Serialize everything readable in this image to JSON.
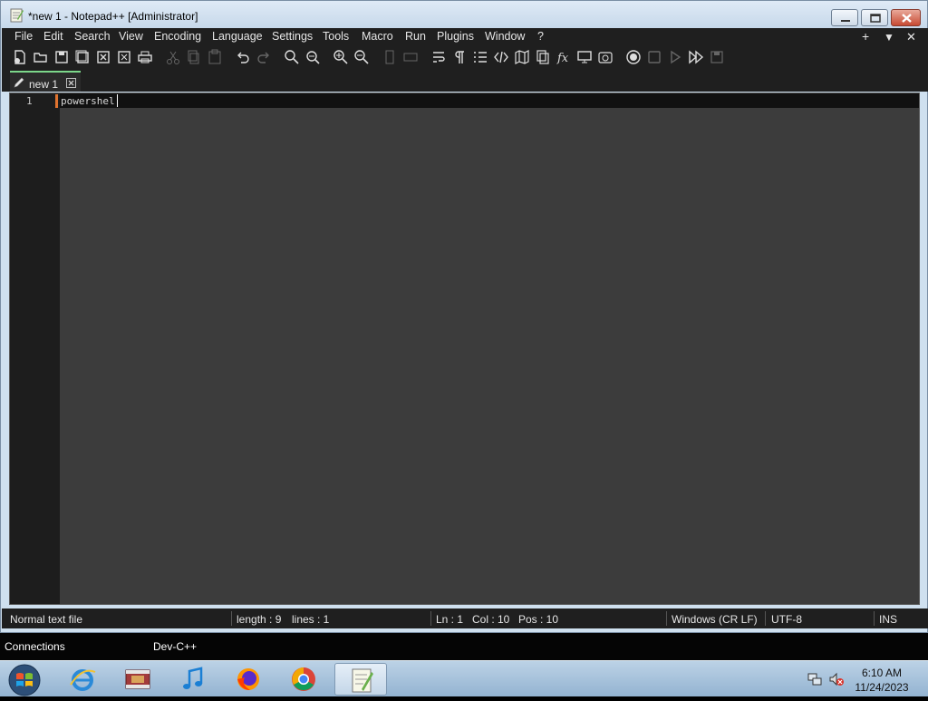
{
  "window": {
    "title": "*new 1 - Notepad++ [Administrator]"
  },
  "menu": {
    "items": [
      "File",
      "Edit",
      "Search",
      "View",
      "Encoding",
      "Language",
      "Settings",
      "Tools",
      "Macro",
      "Run",
      "Plugins",
      "Window",
      "?"
    ],
    "right": [
      "+",
      "▼",
      "✕"
    ]
  },
  "tabs": [
    {
      "label": "new 1"
    }
  ],
  "editor": {
    "line_number": "1",
    "text": "powershel"
  },
  "status": {
    "file_type": "Normal text file",
    "length": "length : 9",
    "lines": "lines : 1",
    "ln": "Ln : 1",
    "col": "Col : 10",
    "pos": "Pos : 10",
    "eol": "Windows (CR LF)",
    "encoding": "UTF-8",
    "mode": "INS"
  },
  "pinned_bar": {
    "items": [
      "Connections",
      "Dev-C++"
    ]
  },
  "taskbar": {
    "time": "6:10 AM",
    "date": "11/24/2023"
  },
  "colors": {
    "tab_accent": "#7cd78a",
    "menu_bg": "#1f1f1f",
    "editor_bg": "#3c3c3c"
  }
}
